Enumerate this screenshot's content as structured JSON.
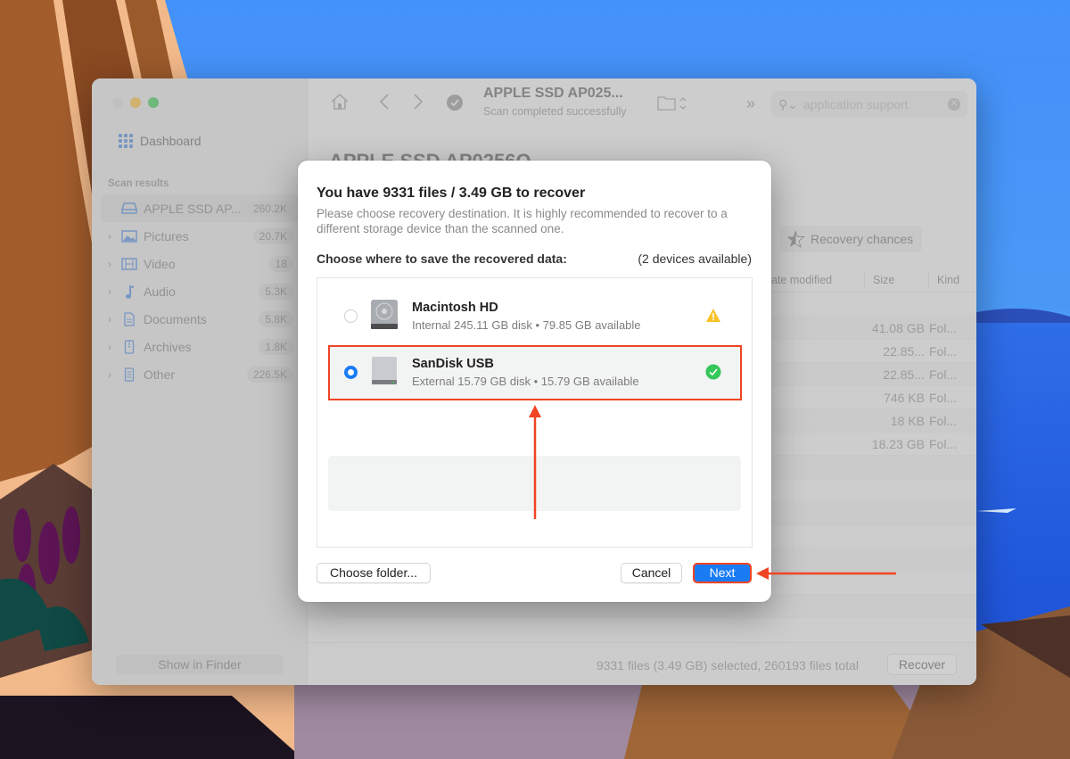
{
  "colors": {
    "accent": "#1a7cf5",
    "annotation": "#f04424",
    "warning": "#f7c326",
    "success": "#34c759"
  },
  "window": {
    "sidebar": {
      "dashboard_label": "Dashboard",
      "section_label": "Scan results",
      "items": [
        {
          "label": "APPLE SSD AP...",
          "count": "260.2K",
          "icon": "drive-icon",
          "active": true
        },
        {
          "label": "Pictures",
          "count": "20.7K",
          "icon": "pictures-icon"
        },
        {
          "label": "Video",
          "count": "18",
          "icon": "video-icon"
        },
        {
          "label": "Audio",
          "count": "5.3K",
          "icon": "audio-icon"
        },
        {
          "label": "Documents",
          "count": "5.8K",
          "icon": "documents-icon"
        },
        {
          "label": "Archives",
          "count": "1.8K",
          "icon": "archives-icon"
        },
        {
          "label": "Other",
          "count": "226.5K",
          "icon": "other-icon"
        }
      ],
      "show_in_finder_label": "Show in Finder"
    },
    "toolbar": {
      "title": "APPLE SSD AP025...",
      "subtitle": "Scan completed successfully",
      "search_value": "application support"
    },
    "main": {
      "title": "APPLE SSD AP0256Q",
      "recovery_chances_label": "Recovery chances",
      "columns": {
        "date_modified": "ate modified",
        "size": "Size",
        "kind": "Kind"
      },
      "rows": [
        {
          "size": "",
          "kind": ""
        },
        {
          "size": "41.08 GB",
          "kind": "Fol..."
        },
        {
          "size": "22.85...",
          "kind": "Fol..."
        },
        {
          "size": "22.85...",
          "kind": "Fol..."
        },
        {
          "size": "746 KB",
          "kind": "Fol..."
        },
        {
          "size": "18 KB",
          "kind": "Fol..."
        },
        {
          "size": "18.23 GB",
          "kind": "Fol..."
        }
      ]
    },
    "status": {
      "text": "9331 files (3.49 GB) selected, 260193 files total",
      "recover_label": "Recover"
    }
  },
  "dialog": {
    "title": "You have 9331 files / 3.49 GB to recover",
    "description": "Please choose recovery destination. It is highly recommended to recover to a different storage device than the scanned one.",
    "choose_label": "Choose where to save the recovered data:",
    "devices_count": "(2 devices available)",
    "devices": [
      {
        "name": "Macintosh HD",
        "info": "Internal 245.11 GB disk • 79.85 GB available",
        "status": "warning",
        "selected": false
      },
      {
        "name": "SanDisk USB",
        "info": "External 15.79 GB disk • 15.79 GB available",
        "status": "ok",
        "selected": true
      }
    ],
    "buttons": {
      "choose_folder": "Choose folder...",
      "cancel": "Cancel",
      "next": "Next"
    }
  }
}
